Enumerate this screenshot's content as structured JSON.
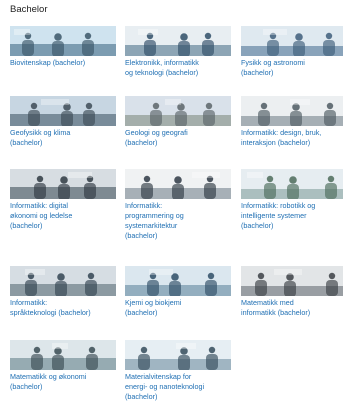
{
  "section": {
    "title": "Bachelor"
  },
  "programs": [
    {
      "label": "Biovitenskap (bachelor)",
      "colors": [
        "#cfe3ef",
        "#6d8fa6",
        "#3b5667"
      ]
    },
    {
      "label": "Elektronikk, informatikk\nog teknologi (bachelor)",
      "colors": [
        "#e8eef2",
        "#7d98aa",
        "#2f4d67"
      ]
    },
    {
      "label": "Fysikk og astronomi\n(bachelor)",
      "colors": [
        "#dfe9f0",
        "#7a97b0",
        "#3e5d7a"
      ]
    },
    {
      "label": "Geofysikk og klima\n(bachelor)",
      "colors": [
        "#c7d6e2",
        "#6b7f8d",
        "#3d4b56"
      ]
    },
    {
      "label": "Geologi og geografi\n(bachelor)",
      "colors": [
        "#d9e1ea",
        "#9aa5a0",
        "#5b6468"
      ]
    },
    {
      "label": "Informatikk: design, bruk,\ninteraksjon (bachelor)",
      "colors": [
        "#eceff1",
        "#9aa3aa",
        "#4f5a63"
      ]
    },
    {
      "label": "Informatikk: digital\nøkonomi og ledelse\n(bachelor)",
      "colors": [
        "#d7dde2",
        "#6f7b84",
        "#2f3942"
      ]
    },
    {
      "label": "Informatikk:\nprogrammering og\nsystemarkitektur\n(bachelor)",
      "colors": [
        "#f0f2f3",
        "#9aa4ab",
        "#2f3a44"
      ]
    },
    {
      "label": "Informatikk: robotikk og\nintelligente systemer\n(bachelor)",
      "colors": [
        "#e6edf1",
        "#a0b6b6",
        "#4c6b5b"
      ]
    },
    {
      "label": "Informatikk:\nspråkteknologi (bachelor)",
      "colors": [
        "#d6dde3",
        "#7f8e97",
        "#324452"
      ]
    },
    {
      "label": "Kjemi og biokjemi\n(bachelor)",
      "colors": [
        "#dbe7ef",
        "#86a3b6",
        "#2f4d66"
      ]
    },
    {
      "label": "Matematikk med\ninformatikk (bachelor)",
      "colors": [
        "#e2e5e7",
        "#8c9296",
        "#3b3f44"
      ]
    },
    {
      "label": "Matematikk og økonomi\n(bachelor)",
      "colors": [
        "#dde6ea",
        "#8aa0a8",
        "#3a4b53"
      ]
    },
    {
      "label": "Materialvitenskap for\nenergi- og nanoteknologi\n(bachelor)",
      "colors": [
        "#e6eef3",
        "#93aab8",
        "#344b5b"
      ]
    }
  ]
}
